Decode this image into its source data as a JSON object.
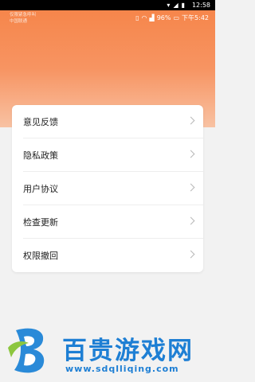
{
  "system_bar": {
    "time": "12:58"
  },
  "status_bar": {
    "carrier_line1": "仅限紧急呼叫",
    "carrier_line2": "中国联通",
    "battery": "96%",
    "time": "下午5:42"
  },
  "settings": {
    "items": [
      {
        "label": "意见反馈"
      },
      {
        "label": "隐私政策"
      },
      {
        "label": "用户协议"
      },
      {
        "label": "检查更新"
      },
      {
        "label": "权限撤回"
      }
    ]
  },
  "watermark": {
    "title": "百贵游戏网",
    "url": "www.sdqlliqing.com"
  },
  "colors": {
    "header_top": "#f6864b",
    "header_bottom": "#f8c2a3",
    "watermark_blue": "#1e7fd4"
  }
}
